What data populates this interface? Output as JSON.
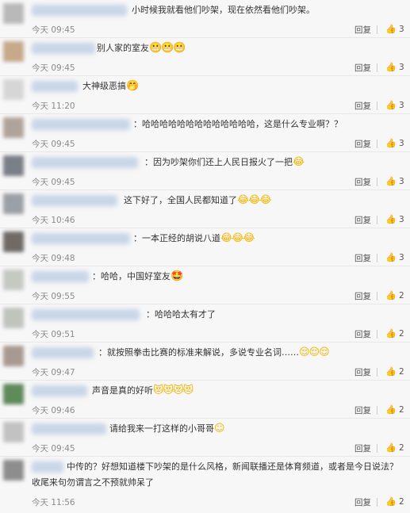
{
  "comments": [
    {
      "text": "小时候我就看他们吵架，现在依然看他们吵架。",
      "emoji": "",
      "time": "今天 09:45",
      "likes": "3",
      "avatar_color": "#b9b9b9"
    },
    {
      "text": "别人家的室友",
      "emoji": "😬😬😬",
      "time": "今天 09:45",
      "likes": "3",
      "avatar_color": "#c6a98a"
    },
    {
      "text": "大神级恶搞",
      "emoji": "🤭",
      "time": "今天 11:20",
      "likes": "3",
      "avatar_color": "#d6d6d6"
    },
    {
      "text": "：哈哈哈哈哈哈哈哈哈哈哈哈哈，这是什么专业啊？？",
      "emoji": "",
      "time": "今天 09:45",
      "likes": "3",
      "avatar_color": "#b0a49a"
    },
    {
      "text": "：因为吵架你们还上人民日报火了一把",
      "emoji": "😂",
      "time": "今天 09:45",
      "likes": "3",
      "avatar_color": "#7a7f88"
    },
    {
      "text": "这下好了，全国人民都知道了",
      "emoji": "😂😂😂",
      "time": "今天 10:46",
      "likes": "3",
      "avatar_color": "#9aa0a6"
    },
    {
      "text": "：一本正经的胡说八道",
      "emoji": "😂😂😂",
      "time": "今天 09:48",
      "likes": "3",
      "avatar_color": "#6f6a66"
    },
    {
      "text": "：哈哈，中国好室友",
      "emoji": "🤩",
      "time": "今天 09:55",
      "likes": "2",
      "avatar_color": "#c4c9c2"
    },
    {
      "text": "：哈哈哈太有才了",
      "emoji": "",
      "time": "今天 09:51",
      "likes": "2",
      "avatar_color": "#bfc4bd"
    },
    {
      "text": "：就按照拳击比赛的标准来解说，多说专业名词……",
      "emoji": "😌😌😌",
      "time": "今天 09:47",
      "likes": "2",
      "avatar_color": "#a89a90"
    },
    {
      "text": "声音是真的好听",
      "emoji": "😻😻😻😻",
      "time": "今天 09:46",
      "likes": "2",
      "avatar_color": "#5f8a5a"
    },
    {
      "text": "请给我来一打这样的小哥哥",
      "emoji": "☺",
      "time": "今天 09:45",
      "likes": "2",
      "avatar_color": "#c2c2c2"
    },
    {
      "text": "中传的？好想知道楼下吵架的是什么风格，新闻联播还是体育频道，或者是今日说法？收尾来句勿谓言之不预就帅呆了",
      "emoji": "",
      "time": "今天 11:56",
      "likes": "2",
      "avatar_color": "#8d8d8d"
    }
  ],
  "labels": {
    "reply": "回复",
    "like_icon": "thumbs-up-icon"
  },
  "colors": {
    "background": "#f7f7f7",
    "time": "#8a8a8a",
    "emoji": "#f5b400"
  }
}
